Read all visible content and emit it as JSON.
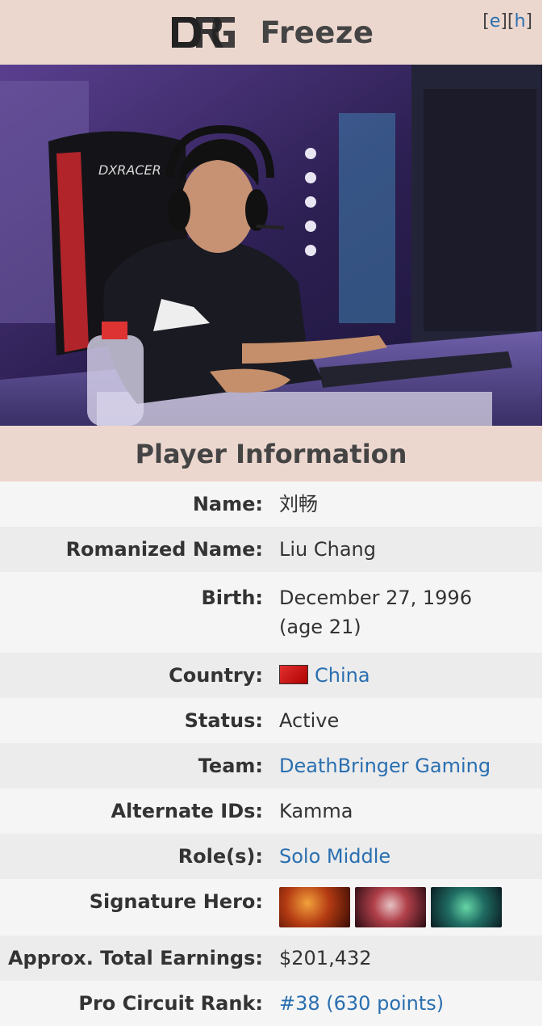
{
  "header": {
    "logo_text": "DRG",
    "title": "Freeze",
    "edit_link": "e",
    "history_link": "h"
  },
  "photo": {
    "description_icon": "player-photo",
    "chair_brand": "DXRACER"
  },
  "section": {
    "title": "Player Information"
  },
  "rows": [
    {
      "label": "Name:",
      "value": "刘畅"
    },
    {
      "label": "Romanized Name:",
      "value": "Liu Chang"
    },
    {
      "label": "Birth:",
      "value": "December 27, 1996",
      "value2": "(age 21)"
    },
    {
      "label": "Country:",
      "value": "China",
      "icon": "china-flag-icon"
    },
    {
      "label": "Status:",
      "value": "Active"
    },
    {
      "label": "Team:",
      "value": "DeathBringer Gaming"
    },
    {
      "label": "Alternate IDs:",
      "value": "Kamma"
    },
    {
      "label": "Role(s):",
      "value": "Solo Middle"
    },
    {
      "label": "Signature Hero:",
      "heroes": [
        "hero-icon-1",
        "hero-icon-2",
        "hero-icon-3"
      ]
    },
    {
      "label": "Approx. Total Earnings:",
      "value": "$201,432"
    },
    {
      "label": "Pro Circuit Rank:",
      "value": "#38 (630 points)"
    }
  ],
  "colors": {
    "header_bg": "#ecd7cf",
    "link": "#2a6fb0",
    "row_odd": "#f5f5f5",
    "row_even": "#ececec"
  }
}
